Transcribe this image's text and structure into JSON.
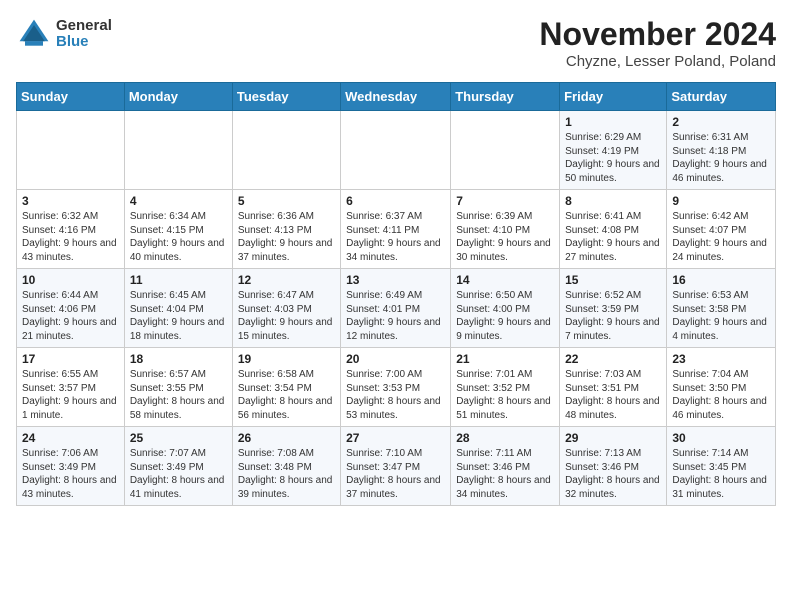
{
  "header": {
    "logo_general": "General",
    "logo_blue": "Blue",
    "month_title": "November 2024",
    "subtitle": "Chyzne, Lesser Poland, Poland"
  },
  "calendar": {
    "days_of_week": [
      "Sunday",
      "Monday",
      "Tuesday",
      "Wednesday",
      "Thursday",
      "Friday",
      "Saturday"
    ],
    "weeks": [
      [
        {
          "day": "",
          "info": ""
        },
        {
          "day": "",
          "info": ""
        },
        {
          "day": "",
          "info": ""
        },
        {
          "day": "",
          "info": ""
        },
        {
          "day": "",
          "info": ""
        },
        {
          "day": "1",
          "info": "Sunrise: 6:29 AM\nSunset: 4:19 PM\nDaylight: 9 hours and 50 minutes."
        },
        {
          "day": "2",
          "info": "Sunrise: 6:31 AM\nSunset: 4:18 PM\nDaylight: 9 hours and 46 minutes."
        }
      ],
      [
        {
          "day": "3",
          "info": "Sunrise: 6:32 AM\nSunset: 4:16 PM\nDaylight: 9 hours and 43 minutes."
        },
        {
          "day": "4",
          "info": "Sunrise: 6:34 AM\nSunset: 4:15 PM\nDaylight: 9 hours and 40 minutes."
        },
        {
          "day": "5",
          "info": "Sunrise: 6:36 AM\nSunset: 4:13 PM\nDaylight: 9 hours and 37 minutes."
        },
        {
          "day": "6",
          "info": "Sunrise: 6:37 AM\nSunset: 4:11 PM\nDaylight: 9 hours and 34 minutes."
        },
        {
          "day": "7",
          "info": "Sunrise: 6:39 AM\nSunset: 4:10 PM\nDaylight: 9 hours and 30 minutes."
        },
        {
          "day": "8",
          "info": "Sunrise: 6:41 AM\nSunset: 4:08 PM\nDaylight: 9 hours and 27 minutes."
        },
        {
          "day": "9",
          "info": "Sunrise: 6:42 AM\nSunset: 4:07 PM\nDaylight: 9 hours and 24 minutes."
        }
      ],
      [
        {
          "day": "10",
          "info": "Sunrise: 6:44 AM\nSunset: 4:06 PM\nDaylight: 9 hours and 21 minutes."
        },
        {
          "day": "11",
          "info": "Sunrise: 6:45 AM\nSunset: 4:04 PM\nDaylight: 9 hours and 18 minutes."
        },
        {
          "day": "12",
          "info": "Sunrise: 6:47 AM\nSunset: 4:03 PM\nDaylight: 9 hours and 15 minutes."
        },
        {
          "day": "13",
          "info": "Sunrise: 6:49 AM\nSunset: 4:01 PM\nDaylight: 9 hours and 12 minutes."
        },
        {
          "day": "14",
          "info": "Sunrise: 6:50 AM\nSunset: 4:00 PM\nDaylight: 9 hours and 9 minutes."
        },
        {
          "day": "15",
          "info": "Sunrise: 6:52 AM\nSunset: 3:59 PM\nDaylight: 9 hours and 7 minutes."
        },
        {
          "day": "16",
          "info": "Sunrise: 6:53 AM\nSunset: 3:58 PM\nDaylight: 9 hours and 4 minutes."
        }
      ],
      [
        {
          "day": "17",
          "info": "Sunrise: 6:55 AM\nSunset: 3:57 PM\nDaylight: 9 hours and 1 minute."
        },
        {
          "day": "18",
          "info": "Sunrise: 6:57 AM\nSunset: 3:55 PM\nDaylight: 8 hours and 58 minutes."
        },
        {
          "day": "19",
          "info": "Sunrise: 6:58 AM\nSunset: 3:54 PM\nDaylight: 8 hours and 56 minutes."
        },
        {
          "day": "20",
          "info": "Sunrise: 7:00 AM\nSunset: 3:53 PM\nDaylight: 8 hours and 53 minutes."
        },
        {
          "day": "21",
          "info": "Sunrise: 7:01 AM\nSunset: 3:52 PM\nDaylight: 8 hours and 51 minutes."
        },
        {
          "day": "22",
          "info": "Sunrise: 7:03 AM\nSunset: 3:51 PM\nDaylight: 8 hours and 48 minutes."
        },
        {
          "day": "23",
          "info": "Sunrise: 7:04 AM\nSunset: 3:50 PM\nDaylight: 8 hours and 46 minutes."
        }
      ],
      [
        {
          "day": "24",
          "info": "Sunrise: 7:06 AM\nSunset: 3:49 PM\nDaylight: 8 hours and 43 minutes."
        },
        {
          "day": "25",
          "info": "Sunrise: 7:07 AM\nSunset: 3:49 PM\nDaylight: 8 hours and 41 minutes."
        },
        {
          "day": "26",
          "info": "Sunrise: 7:08 AM\nSunset: 3:48 PM\nDaylight: 8 hours and 39 minutes."
        },
        {
          "day": "27",
          "info": "Sunrise: 7:10 AM\nSunset: 3:47 PM\nDaylight: 8 hours and 37 minutes."
        },
        {
          "day": "28",
          "info": "Sunrise: 7:11 AM\nSunset: 3:46 PM\nDaylight: 8 hours and 34 minutes."
        },
        {
          "day": "29",
          "info": "Sunrise: 7:13 AM\nSunset: 3:46 PM\nDaylight: 8 hours and 32 minutes."
        },
        {
          "day": "30",
          "info": "Sunrise: 7:14 AM\nSunset: 3:45 PM\nDaylight: 8 hours and 31 minutes."
        }
      ]
    ]
  }
}
